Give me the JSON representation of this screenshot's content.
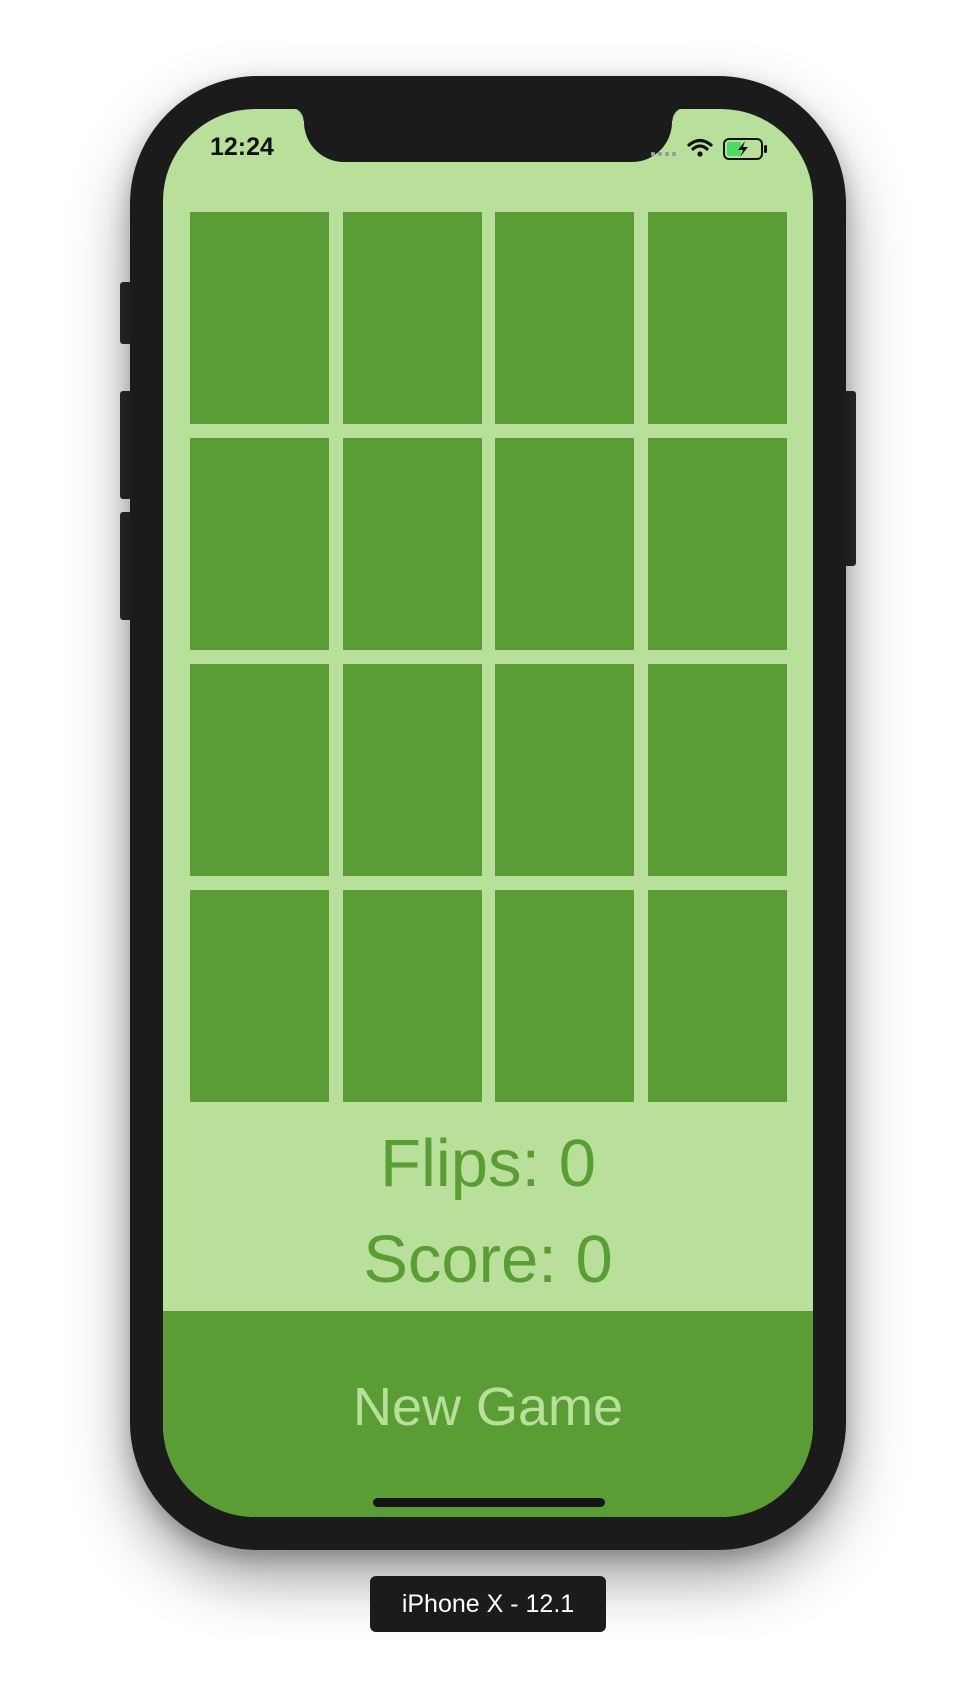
{
  "status_bar": {
    "time": "12:24",
    "icons": [
      "cellular-signal-icon",
      "wifi-icon",
      "battery-charging-icon"
    ]
  },
  "game": {
    "card_count": 16,
    "flips_label": "Flips: 0",
    "score_label": "Score: 0",
    "new_game_label": "New Game"
  },
  "device_label": "iPhone X - 12.1",
  "colors": {
    "background": "#b8e09a",
    "card_back": "#5a9d34",
    "text_accent": "#5a9d34",
    "button_text": "#b8e09a",
    "device_frame": "#1b1b1b"
  }
}
